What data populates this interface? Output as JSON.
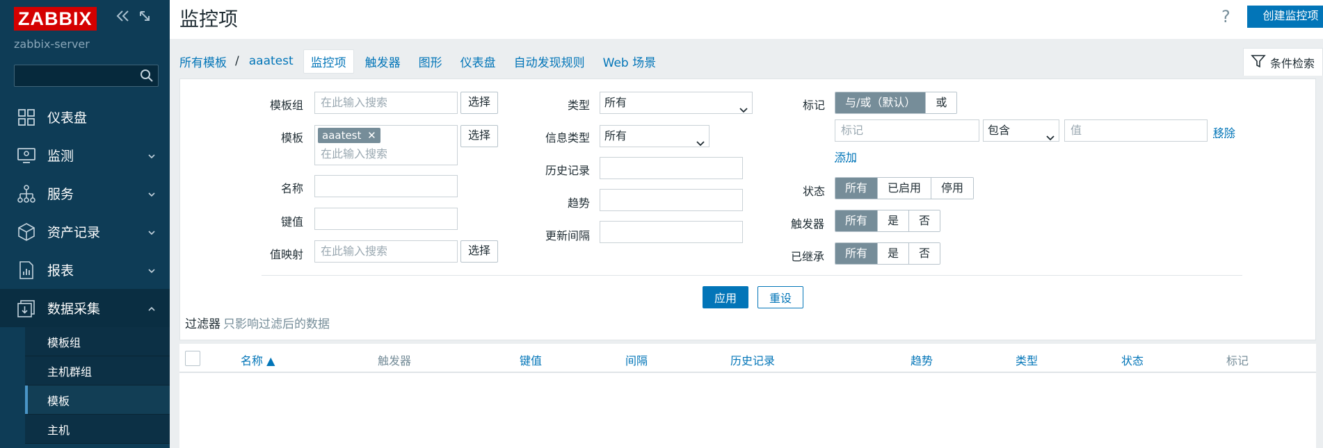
{
  "app": {
    "logo": "ZABBIX",
    "server": "zabbix-server"
  },
  "sidebar": {
    "items": [
      {
        "label": "仪表盘"
      },
      {
        "label": "监测"
      },
      {
        "label": "服务"
      },
      {
        "label": "资产记录"
      },
      {
        "label": "报表"
      },
      {
        "label": "数据采集"
      }
    ],
    "sub_items": [
      {
        "label": "模板组"
      },
      {
        "label": "主机群组"
      },
      {
        "label": "模板"
      },
      {
        "label": "主机"
      }
    ]
  },
  "header": {
    "title": "监控项",
    "help": "?",
    "create_label": "创建监控项"
  },
  "subnav": {
    "all_templates": "所有模板",
    "separator": "/",
    "template": "aaatest",
    "tabs": [
      "监控项",
      "触发器",
      "图形",
      "仪表盘",
      "自动发现规则",
      "Web 场景"
    ],
    "filter_tab": "条件检索"
  },
  "filter": {
    "template_group_label": "模板组",
    "template_label": "模板",
    "name_label": "名称",
    "key_label": "键值",
    "value_map_label": "值映射",
    "search_placeholder": "在此输入搜索",
    "select_label": "选择",
    "template_chip": "aaatest",
    "type_label": "类型",
    "type_value": "所有",
    "info_type_label": "信息类型",
    "info_type_value": "所有",
    "history_label": "历史记录",
    "trends_label": "趋势",
    "interval_label": "更新间隔",
    "tags_label": "标记",
    "tags_andor": "与/或（默认）",
    "tags_or": "或",
    "tag_placeholder": "标记",
    "tag_op": "包含",
    "value_placeholder": "值",
    "remove": "移除",
    "add": "添加",
    "status_label": "状态",
    "status_options": [
      "所有",
      "已启用",
      "停用"
    ],
    "triggers_label": "触发器",
    "triggers_options": [
      "所有",
      "是",
      "否"
    ],
    "inherited_label": "已继承",
    "inherited_options": [
      "所有",
      "是",
      "否"
    ],
    "apply": "应用",
    "reset": "重设",
    "note_main": "过滤器",
    "note_sub": "只影响过滤后的数据"
  },
  "table": {
    "columns": [
      "名称 ▲",
      "触发器",
      "键值",
      "间隔",
      "历史记录",
      "趋势",
      "类型",
      "状态",
      "标记"
    ]
  }
}
